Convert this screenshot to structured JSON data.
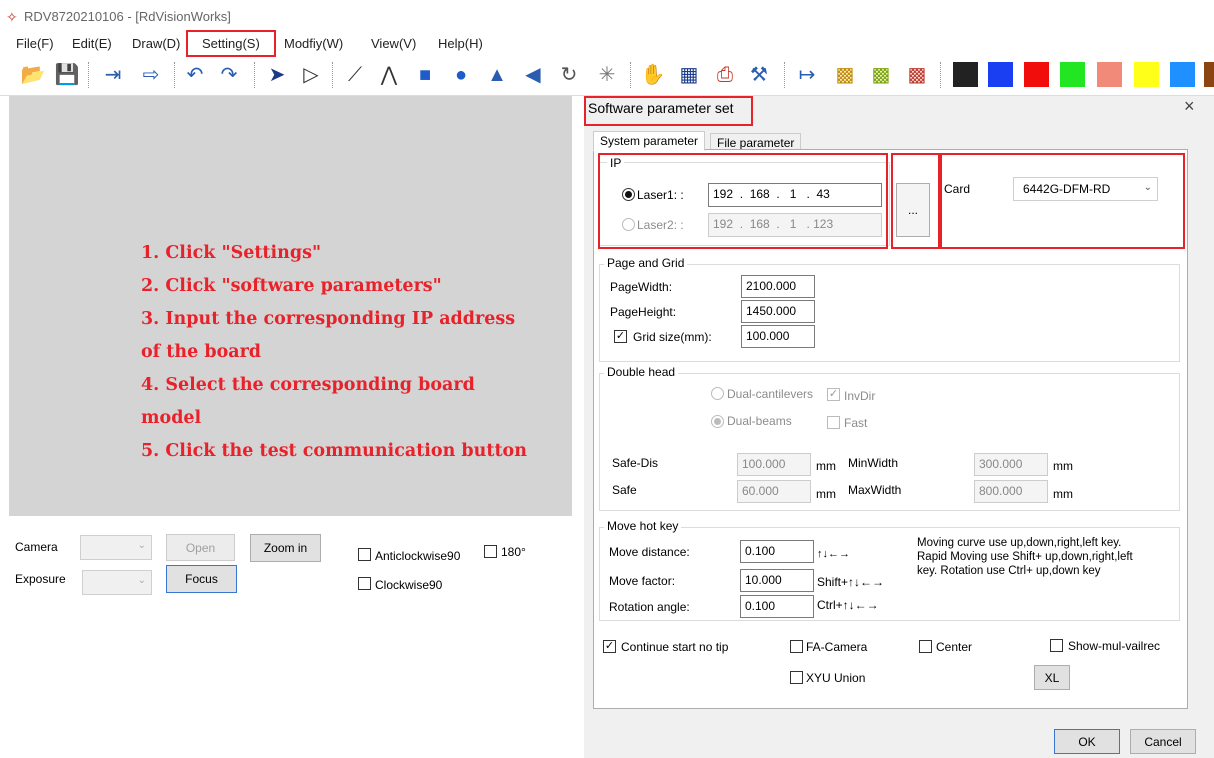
{
  "window": {
    "title": "RDV8720210106 - [RdVisionWorks]"
  },
  "menu": [
    "File(F)",
    "Edit(E)",
    "Draw(D)",
    "Setting(S)",
    "Modfiy(W)",
    "View(V)",
    "Help(H)"
  ],
  "toolbar": {
    "icons": [
      "open-icon",
      "save-icon",
      "import-icon",
      "export-icon",
      "undo-icon",
      "redo-icon",
      "select-icon",
      "node-edit-icon",
      "line-icon",
      "polyline-icon",
      "rectangle-icon",
      "ellipse-icon",
      "mirror-horizontal-icon",
      "mirror-vertical-icon",
      "rotate-icon",
      "star-icon",
      "hand-icon",
      "crop-icon",
      "print-icon",
      "tool-icon",
      "distance-icon",
      "layer-icon-1",
      "layer-icon-2",
      "layer-icon-3"
    ],
    "colors": [
      "#222222",
      "#1a3ff2",
      "#f20d0d",
      "#22e622",
      "#f28a7a",
      "#ffff19",
      "#1e90ff"
    ]
  },
  "instructions": [
    "1. Click \"Settings\"",
    "2. Click \"software parameters\"",
    "3. Input the corresponding IP address",
    "of the board",
    "4. Select the corresponding board",
    "model",
    "5. Click the test communication button"
  ],
  "camera": {
    "camera_label": "Camera",
    "exposure_label": "Exposure",
    "open_label": "Open",
    "zoom_in_label": "Zoom in",
    "focus_label": "Focus",
    "anticlockwise_label": "Anticlockwise90",
    "deg180_label": "180°",
    "clockwise_label": "Clockwise90"
  },
  "dialog": {
    "title": "Software parameter set",
    "close": "×",
    "tabs": [
      "System parameter",
      "File parameter"
    ],
    "ip": {
      "title": "IP",
      "laser1_label": "Laser1: :",
      "laser1_ip": [
        "192",
        "168",
        "1",
        "43"
      ],
      "laser2_label": "Laser2: :",
      "laser2_ip": [
        "192",
        "168",
        "1",
        "123"
      ],
      "test_button": "...",
      "card_label": "Card",
      "card_value": "6442G-DFM-RD"
    },
    "page_grid": {
      "title": "Page and Grid",
      "page_width_label": "PageWidth:",
      "page_width": "2100.000",
      "page_height_label": "PageHeight:",
      "page_height": "1450.000",
      "grid_size_label": "Grid size(mm):",
      "grid_size": "100.000"
    },
    "double_head": {
      "title": "Double head",
      "dual_cantilevers": "Dual-cantilevers",
      "invdir": "InvDir",
      "dual_beams": "Dual-beams",
      "fast": "Fast",
      "safe_dis_label": "Safe-Dis",
      "safe_dis": "100.000",
      "safe_label": "Safe",
      "safe": "60.000",
      "unit": "mm",
      "min_width_label": "MinWidth",
      "min_width": "300.000",
      "max_width_label": "MaxWidth",
      "max_width": "800.000"
    },
    "hotkey": {
      "title": "Move hot key",
      "move_distance_label": "Move distance:",
      "move_distance": "0.100",
      "move_distance_keys": "↑↓←→",
      "move_factor_label": "Move factor:",
      "move_factor": "10.000",
      "move_factor_keys": "Shift+↑↓←→",
      "rotation_label": "Rotation angle:",
      "rotation": "0.100",
      "rotation_keys": "Ctrl+↑↓←→",
      "help_lines": [
        "Moving curve use up,down,right,left key.",
        "Rapid Moving use Shift+ up,down,right,left",
        "key. Rotation use Ctrl+ up,down key"
      ]
    },
    "options": {
      "continue_start": "Continue start no tip",
      "fa_camera": "FA-Camera",
      "center": "Center",
      "show_mul": "Show-mul-vailrec",
      "xyu_union": "XYU Union",
      "xl": "XL"
    },
    "ok": "OK",
    "cancel": "Cancel"
  },
  "highlight_color": "#e8222a"
}
